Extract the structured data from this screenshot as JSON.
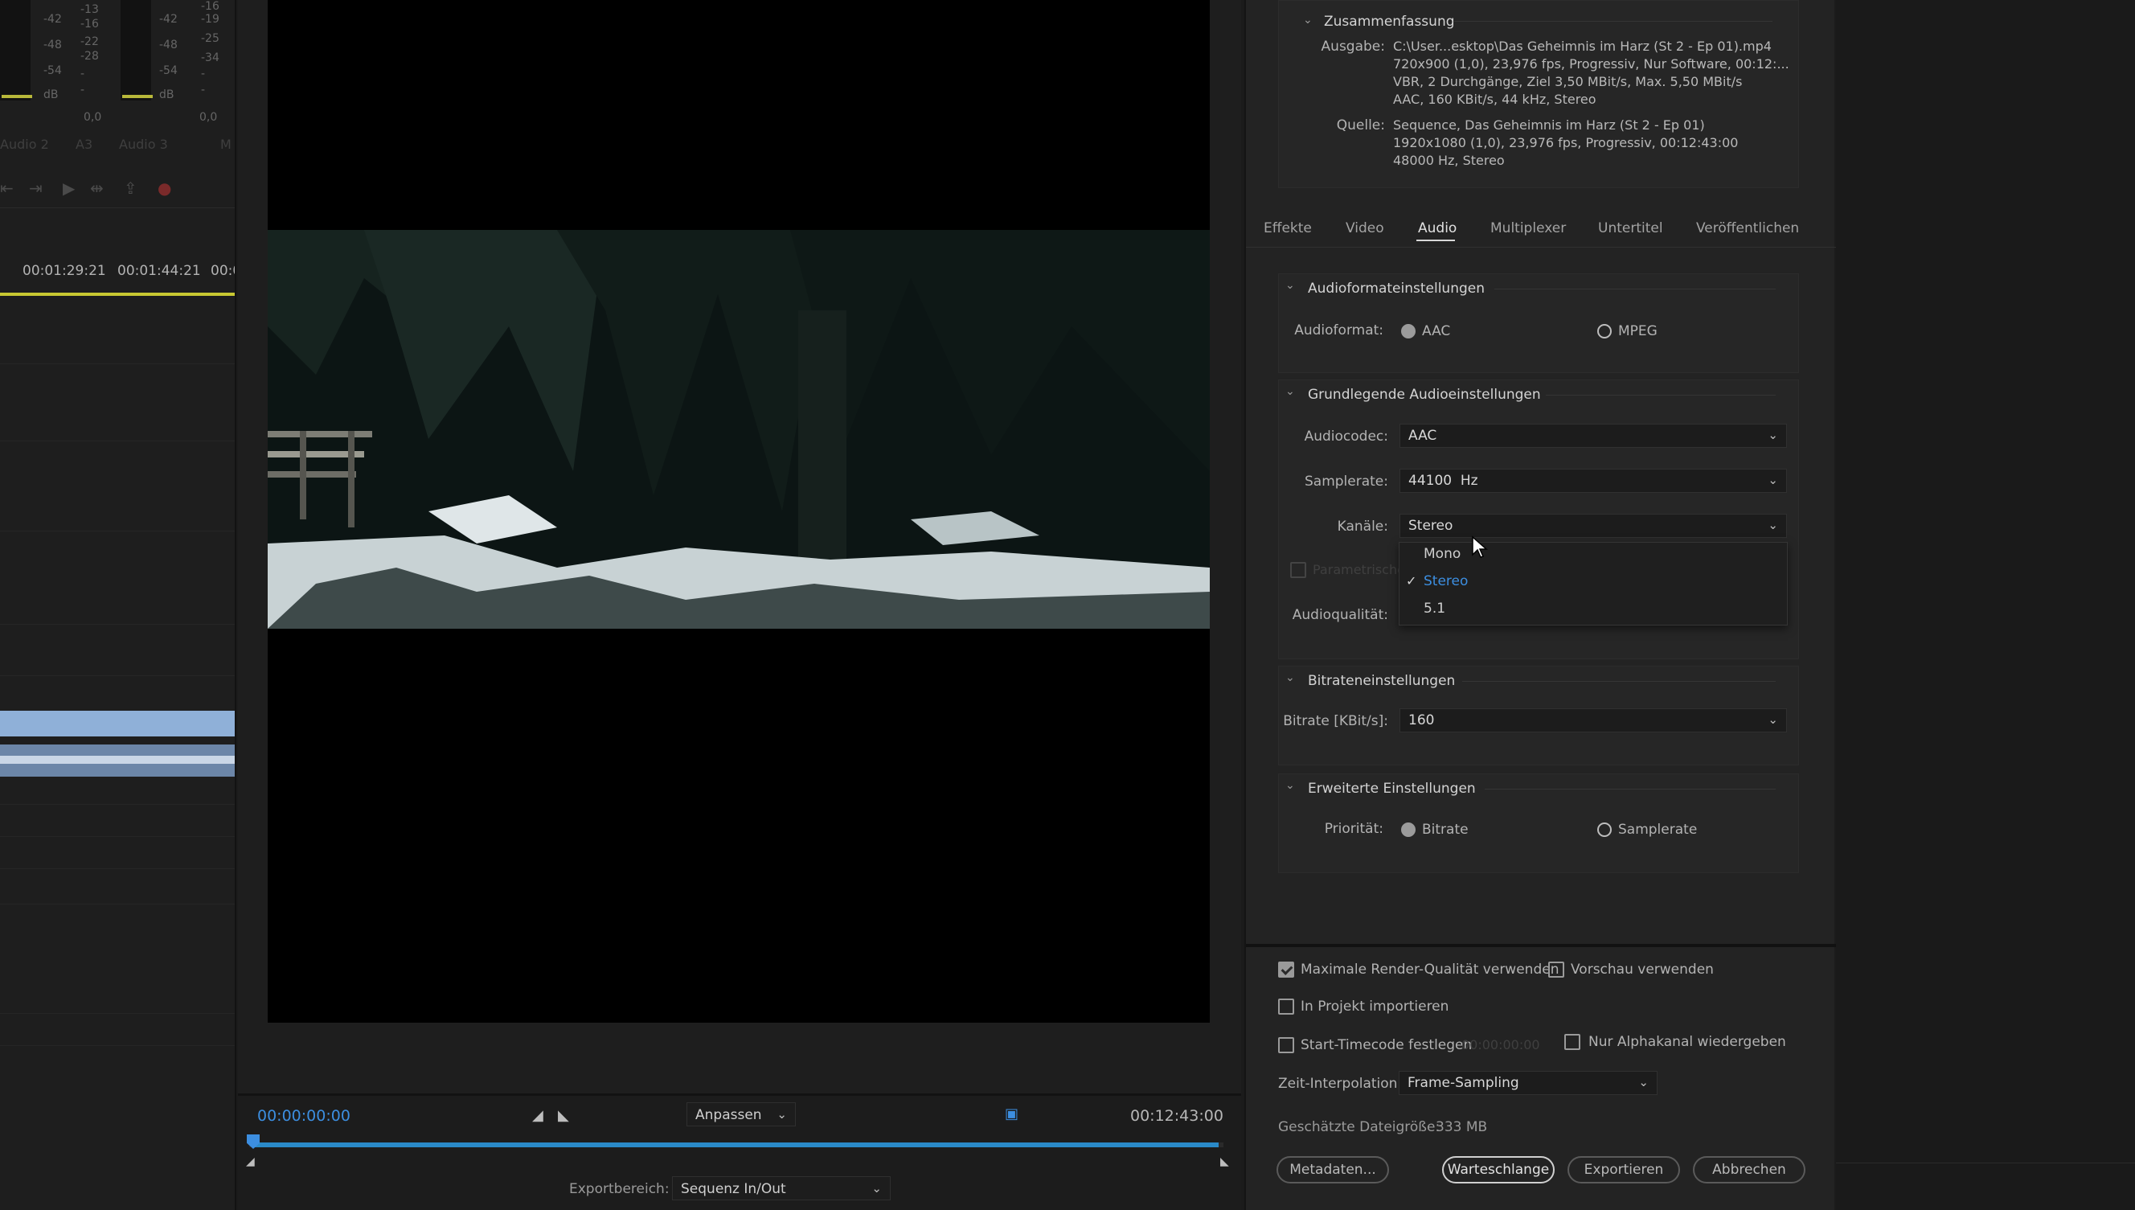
{
  "left_panel": {
    "meter_ticks_col1": [
      "-42",
      "-48",
      "-54",
      "dB"
    ],
    "meter_ticks_col2": [
      "-13",
      "-16",
      "-22",
      "-28",
      "-",
      "-"
    ],
    "meter_ticks_col3": [
      "-42",
      "-48",
      "-54",
      "dB"
    ],
    "meter_ticks_col4": [
      "-16",
      "-19",
      "-25",
      "-34",
      "-",
      "-"
    ],
    "meter_zero_1": "0,0",
    "meter_zero_2": "0,0",
    "track_labels": [
      "Audio 2",
      "A3",
      "Audio 3",
      "M"
    ],
    "ruler_times": [
      "00:01:29:21",
      "00:01:44:21",
      "00:0"
    ]
  },
  "monitor": {
    "current_timecode": "00:00:00:00",
    "duration_timecode": "00:12:43:00",
    "fit_dropdown": "Anpassen",
    "export_range_label": "Exportbereich:",
    "export_range_value": "Sequenz In/Out"
  },
  "summary": {
    "title": "Zusammenfassung",
    "output_label": "Ausgabe:",
    "output_lines": [
      "C:\\User...esktop\\Das Geheimnis im Harz (St 2 - Ep 01).mp4",
      "720x900 (1,0), 23,976 fps, Progressiv, Nur Software, 00:12:...",
      "VBR, 2 Durchgänge, Ziel 3,50 MBit/s, Max. 5,50 MBit/s",
      "AAC, 160 KBit/s, 44 kHz, Stereo"
    ],
    "source_label": "Quelle:",
    "source_lines": [
      "Sequence, Das Geheimnis im Harz (St 2 - Ep 01)",
      "1920x1080 (1,0), 23,976 fps, Progressiv, 00:12:43:00",
      "48000 Hz, Stereo"
    ]
  },
  "tabs": [
    "Effekte",
    "Video",
    "Audio",
    "Multiplexer",
    "Untertitel",
    "Veröffentlichen"
  ],
  "active_tab": "Audio",
  "audio_format": {
    "title": "Audioformateinstellungen",
    "label": "Audioformat:",
    "option_a": "AAC",
    "option_b": "MPEG"
  },
  "basic_audio": {
    "title": "Grundlegende Audioeinstellungen",
    "codec_label": "Audiocodec:",
    "codec_value": "AAC",
    "samplerate_label": "Samplerate:",
    "samplerate_value": "44100  Hz",
    "channels_label": "Kanäle:",
    "channels_value": "Stereo",
    "channels_options": [
      "Mono",
      "Stereo",
      "5.1"
    ],
    "parametric_label": "Parametrische",
    "quality_label": "Audioqualität:"
  },
  "bitrate": {
    "title": "Bitrateneinstellungen",
    "label": "Bitrate [KBit/s]:",
    "value": "160"
  },
  "advanced": {
    "title": "Erweiterte Einstellungen",
    "priority_label": "Priorität:",
    "option_a": "Bitrate",
    "option_b": "Samplerate"
  },
  "bottom": {
    "max_render_quality": "Maximale Render-Qualität verwenden",
    "use_preview": "Vorschau verwenden",
    "import_into_project": "In Projekt importieren",
    "set_start_timecode": "Start-Timecode festlegen",
    "start_timecode_value": "00:00:00:00",
    "alpha_only": "Nur Alphakanal wiedergeben",
    "time_interp_label": "Zeit-Interpolation:",
    "time_interp_value": "Frame-Sampling",
    "filesize_label": "Geschätzte Dateigröße:",
    "filesize_value": "333 MB",
    "btn_metadata": "Metadaten...",
    "btn_queue": "Warteschlange",
    "btn_export": "Exportieren",
    "btn_cancel": "Abbrechen"
  },
  "colors": {
    "accent_blue": "#3c8ee0",
    "timeline_bar": "#2a8ac8",
    "audio_clip": "#8fb0d8"
  }
}
